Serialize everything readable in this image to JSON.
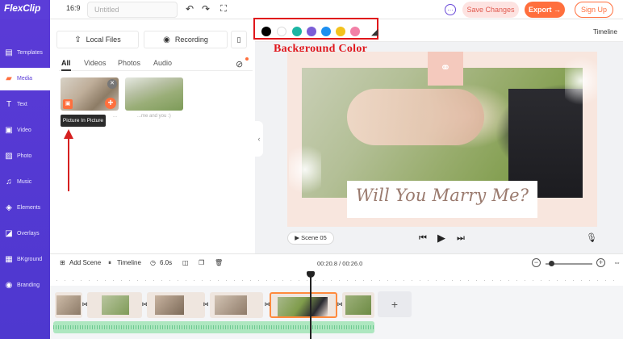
{
  "app": {
    "logo": "FlexClip"
  },
  "header": {
    "aspect_ratio": "16:9",
    "title_placeholder": "Untitled",
    "save_label": "Save Changes",
    "export_label": "Export →",
    "signup_label": "Sign Up"
  },
  "sidebar": {
    "items": [
      {
        "label": "Templates",
        "icon": "templates-icon"
      },
      {
        "label": "Media",
        "icon": "media-icon",
        "active": true
      },
      {
        "label": "Text",
        "icon": "text-icon"
      },
      {
        "label": "Video",
        "icon": "video-icon"
      },
      {
        "label": "Photo",
        "icon": "photo-icon"
      },
      {
        "label": "Music",
        "icon": "music-icon"
      },
      {
        "label": "Elements",
        "icon": "elements-icon"
      },
      {
        "label": "Overlays",
        "icon": "overlays-icon"
      },
      {
        "label": "BKground",
        "icon": "background-icon"
      },
      {
        "label": "Branding",
        "icon": "branding-icon"
      }
    ]
  },
  "media": {
    "local_files_label": "Local Files",
    "recording_label": "Recording",
    "filters": [
      "All",
      "Videos",
      "Photos",
      "Audio"
    ],
    "thumbnails": [
      {
        "caption": "..."
      },
      {
        "caption": "...me and you :)"
      }
    ],
    "tooltip": "Picture In Picture"
  },
  "toolbar": {
    "swatch_colors": [
      "#000000",
      "#ffffff",
      "#1cb5a3",
      "#7b5ed6",
      "#1d8ff0",
      "#f3c21d",
      "#f281a7"
    ],
    "timeline_label": "Timeline"
  },
  "annotation": {
    "label": "Background Color",
    "color": "#e0161b"
  },
  "preview": {
    "headline": "Will You Marry Me?",
    "scene_label": "▶ Scene 05"
  },
  "timeline": {
    "add_scene_label": "Add Scene",
    "timeline_label": "Timeline",
    "duration": "6.0s",
    "time_readout": "00:20.8 / 00:26.0"
  },
  "colors": {
    "brand": "#5b3dd8",
    "accent": "#ff6f3d"
  }
}
